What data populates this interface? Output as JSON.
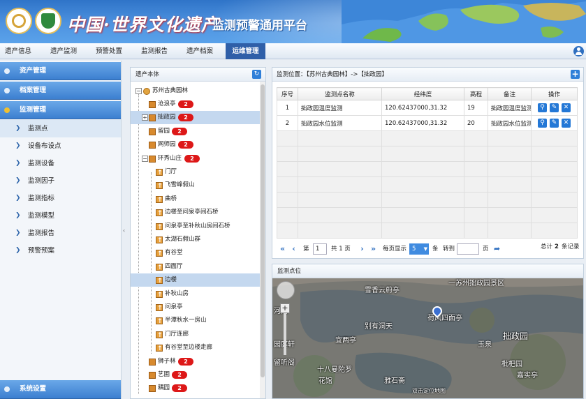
{
  "header": {
    "title_main": "中国·世界文化遗产",
    "title_sub": "监测预警通用平台"
  },
  "nav": {
    "items": [
      "遗产信息",
      "遗产监测",
      "预警处置",
      "监测报告",
      "遗产档案",
      "运维管理"
    ],
    "active": "运维管理"
  },
  "sidebar": {
    "groups_top": [
      "资产管理",
      "档案管理",
      "监测管理"
    ],
    "items": [
      "监测点",
      "设备布设点",
      "监测设备",
      "监测因子",
      "监测指标",
      "监测模型",
      "监测报告",
      "预警预案"
    ],
    "group_bottom": "系统设置"
  },
  "tree": {
    "title": "遗产本体",
    "root": "苏州古典园林",
    "nodes": [
      {
        "label": "沧浪亭",
        "badge": "2"
      },
      {
        "label": "拙政园",
        "badge": "2"
      },
      {
        "label": "留园",
        "badge": "2"
      },
      {
        "label": "网师园",
        "badge": "2"
      },
      {
        "label": "环秀山庄",
        "badge": "2"
      },
      {
        "label": "门厅"
      },
      {
        "label": "飞雪峰假山"
      },
      {
        "label": "曲桥"
      },
      {
        "label": "边楼至问泉亭间石桥"
      },
      {
        "label": "问泉亭至补秋山房间石桥"
      },
      {
        "label": "太湖石假山群"
      },
      {
        "label": "有谷堂"
      },
      {
        "label": "四面厅"
      },
      {
        "label": "边楼"
      },
      {
        "label": "补秋山房"
      },
      {
        "label": "问泉亭"
      },
      {
        "label": "半潭秋水一房山"
      },
      {
        "label": "门厅连廊"
      },
      {
        "label": "有谷堂至边楼走廊"
      },
      {
        "label": "狮子林",
        "badge": "2"
      },
      {
        "label": "艺圃",
        "badge": "2"
      },
      {
        "label": "耦园",
        "badge": "2"
      }
    ]
  },
  "grid": {
    "breadcrumb": "监测位置：【苏州古典园林】->【拙政园】",
    "columns": [
      "序号",
      "监测点名称",
      "经纬度",
      "高程",
      "备注",
      "操作"
    ],
    "rows": [
      {
        "no": "1",
        "name": "拙政园温度监测",
        "coord": "120.62437000,31.32",
        "elev": "19",
        "note": "拙政园温度监测"
      },
      {
        "no": "2",
        "name": "拙政园水位监测",
        "coord": "120.62437000,31.32",
        "elev": "20",
        "note": "拙政园水位监测"
      }
    ],
    "pager": {
      "page_prefix": "第",
      "page": "1",
      "total_pages_text": "共 1 页",
      "per_page_label": "每页显示",
      "per_page": "5",
      "items_unit": "条",
      "goto_label": "转到",
      "page_unit": "页",
      "total_text": "总计",
      "total_count": "2",
      "total_unit": "条记录"
    }
  },
  "map": {
    "title": "监测点位",
    "labels": [
      "一苏州拙政园景区",
      "雪香云蔚亭",
      "别有洞天",
      "荷风四面亭",
      "拙政园",
      "宜两亭",
      "玉泉",
      "留听阁",
      "十八曼陀罗",
      "花馆",
      "雅石斋",
      "枇杷园",
      "嘉实亭",
      "双击定位地图",
      "河间",
      "园庭轩"
    ]
  },
  "colors": {
    "accent": "#2f5fa8",
    "badge": "#dd1818",
    "header_blue": "#3c7fd0"
  }
}
